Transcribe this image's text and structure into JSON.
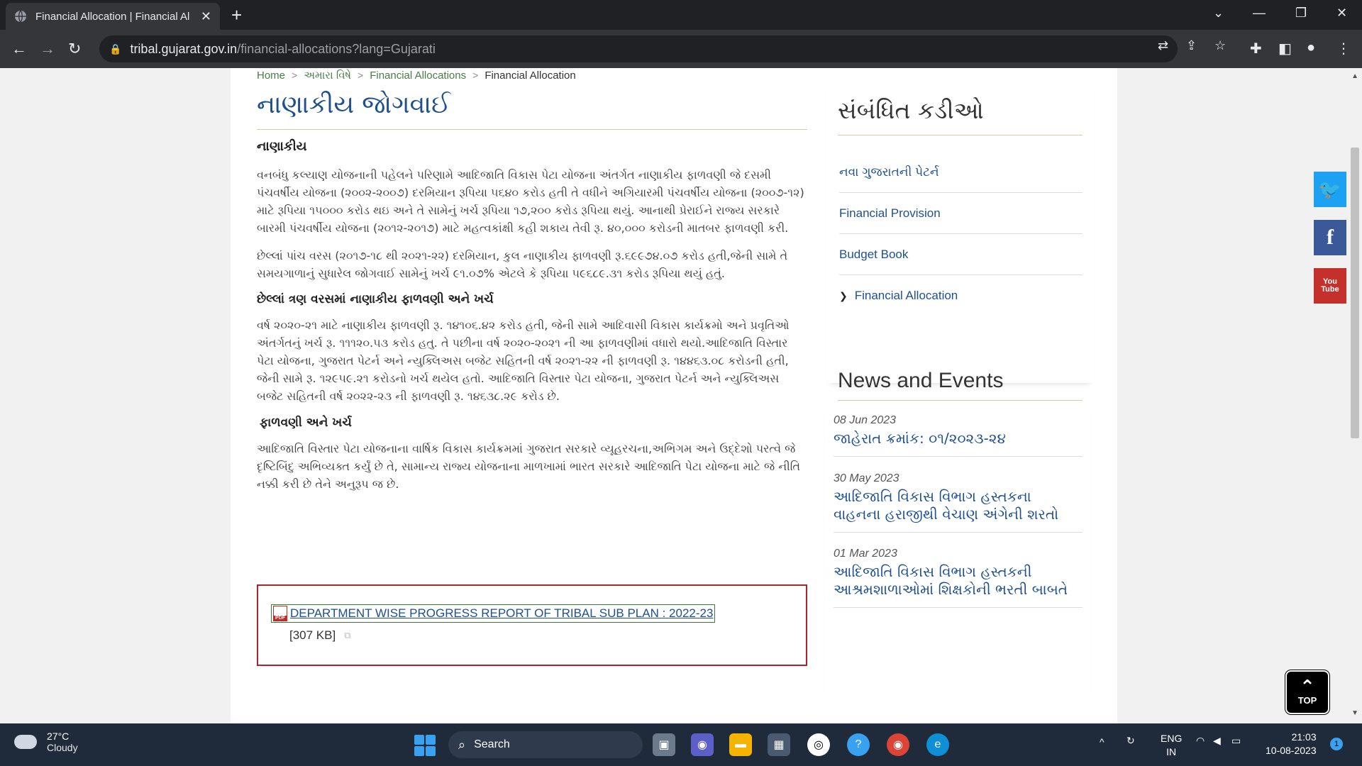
{
  "browser": {
    "tab_title": "Financial Allocation | Financial Al",
    "url_host": "tribal.gujarat.gov.in",
    "url_path": "/financial-allocations?lang=Gujarati"
  },
  "breadcrumb": {
    "items": [
      "Home",
      "અમારા વિષે",
      "Financial Allocations",
      "Financial Allocation"
    ]
  },
  "main": {
    "title": "નાણાકીય જોગવાઈ",
    "section1_heading": "નાણાકીય",
    "para1": "વનબંધુ કલ્યાણ યોજનાની પહેલને પરિણામે આદિજાતિ વિકાસ પેટા યોજના અંતર્ગત નાણાકીય ફાળવણી જે દસમી પંચવર્ષીય યોજના (૨૦૦૨-૨૦૦૭) દરમિયાન રૂપિયા ૫૬૪૦ કરોડ હતી તે વધીને અગિયારમી પંચવર્ષીય યોજના (૨૦૦૭-૧૨) માટે રૂપિયા ૧૫૦૦૦ કરોડ થઇ અને તે સામેનું ખર્ચ રૂપિયા ૧૭,૨૦૦ કરોડ રૂપિયા થયું. આનાથી પ્રેરાઈને રાજ્ય સરકારે બારમી પંચવર્ષીય યોજના (૨૦૧૨-૨૦૧૭) માટે મહત્વકાંક્ષી કહી શકાય તેવી રૂ. ૪૦,૦૦૦ કરોડની માતબર ફાળવણી કરી.",
    "para2": "છેલ્લાં પાંચ વરસ (૨૦૧૭-૧૮ થી ૨૦૨૧-૨૨) દરમિયાન, કુલ નાણાકીય ફાળવણી રૂ.૬૯૯૭૪.૦૭ કરોડ હતી,જેની સામે તે સમયગાળાનું સુધારેલ જોગવાઈ સામેનું ખર્ચ ૯૧.૦૭% એટલે કે રૂપિયા ૫૯૬૮૯.૩૧ કરોડ રૂપિયા થયું હતું.",
    "section2_heading": "છેલ્લાં ત્રણ વરસમાં નાણાકીય ફાળવણી અને ખર્ચ",
    "para3": "વર્ષ ૨૦૨૦-૨૧ માટે નાણાકીય ફાળવણી રૂ. ૧૪૧૦૬.૪૨ કરોડ હતી, જેની સામે આદિવાસી વિકાસ કાર્યક્રમો અને પ્રવૃતિઓ અંતર્ગતનું ખર્ચ રૂ. ૧૧૧૨૦.૫૩ કરોડ હતુ. તે પછીના વર્ષ ૨૦૨૦-૨૦૨૧ ની આ ફાળવણીમાં વધારો થયો.આદિજાતિ વિસ્તાર પેટા યોજના, ગુજરાત પેટર્ન અને ન્યુક્લિઅસ બજેટ સહિતની વર્ષ ૨૦૨૧-૨૨ ની ફાળવણી રૂ. ૧૪૪૬૩.૦૮ કરોડની હતી, જેની સામે રૂ. ૧૨૯૫૯.૨૧ કરોડનો ખર્ચ થયેલ હતો. આદિજાતિ વિસ્તાર પેટા યોજના, ગુજરાત પેટર્ન અને ન્યુક્લિઅસ બજેટ સહિતની વર્ષ ૨૦૨૨-૨૩ ની ફાળવણી રૂ. ૧૪૬૩૮.૨૯ કરોડ છે.",
    "section3_heading": "ફાળવણી અને ખર્ચ",
    "para4": "આદિજાતિ વિસ્તાર પેટા યોજનાના વાર્ષિક વિકાસ કાર્યક્રમમાં ગુજરાત સરકારે વ્યૂહરચના,અભિગમ અને ઉદ્દેશો પરત્વે જે દૃષ્ટિબિંદુ અભિવ્યક્ત કર્યું છે તે, સામાન્ય રાજ્ય યોજનાના માળખામાં ભારત સરકારે આદિજાતિ પેટા યોજના માટે જે નીતિ નક્કી કરી છે તેને અનુરૂપ જ છે.",
    "download": {
      "icon_label": "PDF",
      "link_text": "DEPARTMENT WISE PROGRESS REPORT OF TRIBAL SUB PLAN : 2022-23",
      "size": "[307 KB]"
    }
  },
  "sidebar": {
    "related_title": "સંબંધિત કડીઓ",
    "related_links": [
      "નવા ગુજરાતની પેટર્ન",
      "Financial Provision",
      "Budget Book",
      "Financial Allocation"
    ],
    "news_title": "News and Events",
    "news": [
      {
        "date": "08 Jun 2023",
        "text": "જાહેરાત ક્રમાંક: ૦૧/૨૦૨૩-૨૪"
      },
      {
        "date": "30 May 2023",
        "text": "આદિજાતિ વિકાસ વિભાગ હસ્તકના વાહનના હરાજીથી વેચાણ અંગેની શરતો"
      },
      {
        "date": "01 Mar 2023",
        "text": "આદિજાતિ વિકાસ વિભાગ હસ્તકની આશ્રમશાળાઓમાં શિક્ષકોની ભરતી બાબતે"
      }
    ]
  },
  "social": {
    "youtube_label": "You Tube"
  },
  "top_button": {
    "label": "TOP"
  },
  "taskbar": {
    "temperature": "27°C",
    "weather": "Cloudy",
    "search_label": "Search",
    "lang_line1": "ENG",
    "lang_line2": "IN",
    "time": "21:03",
    "date": "10-08-2023",
    "notification_count": "1"
  }
}
